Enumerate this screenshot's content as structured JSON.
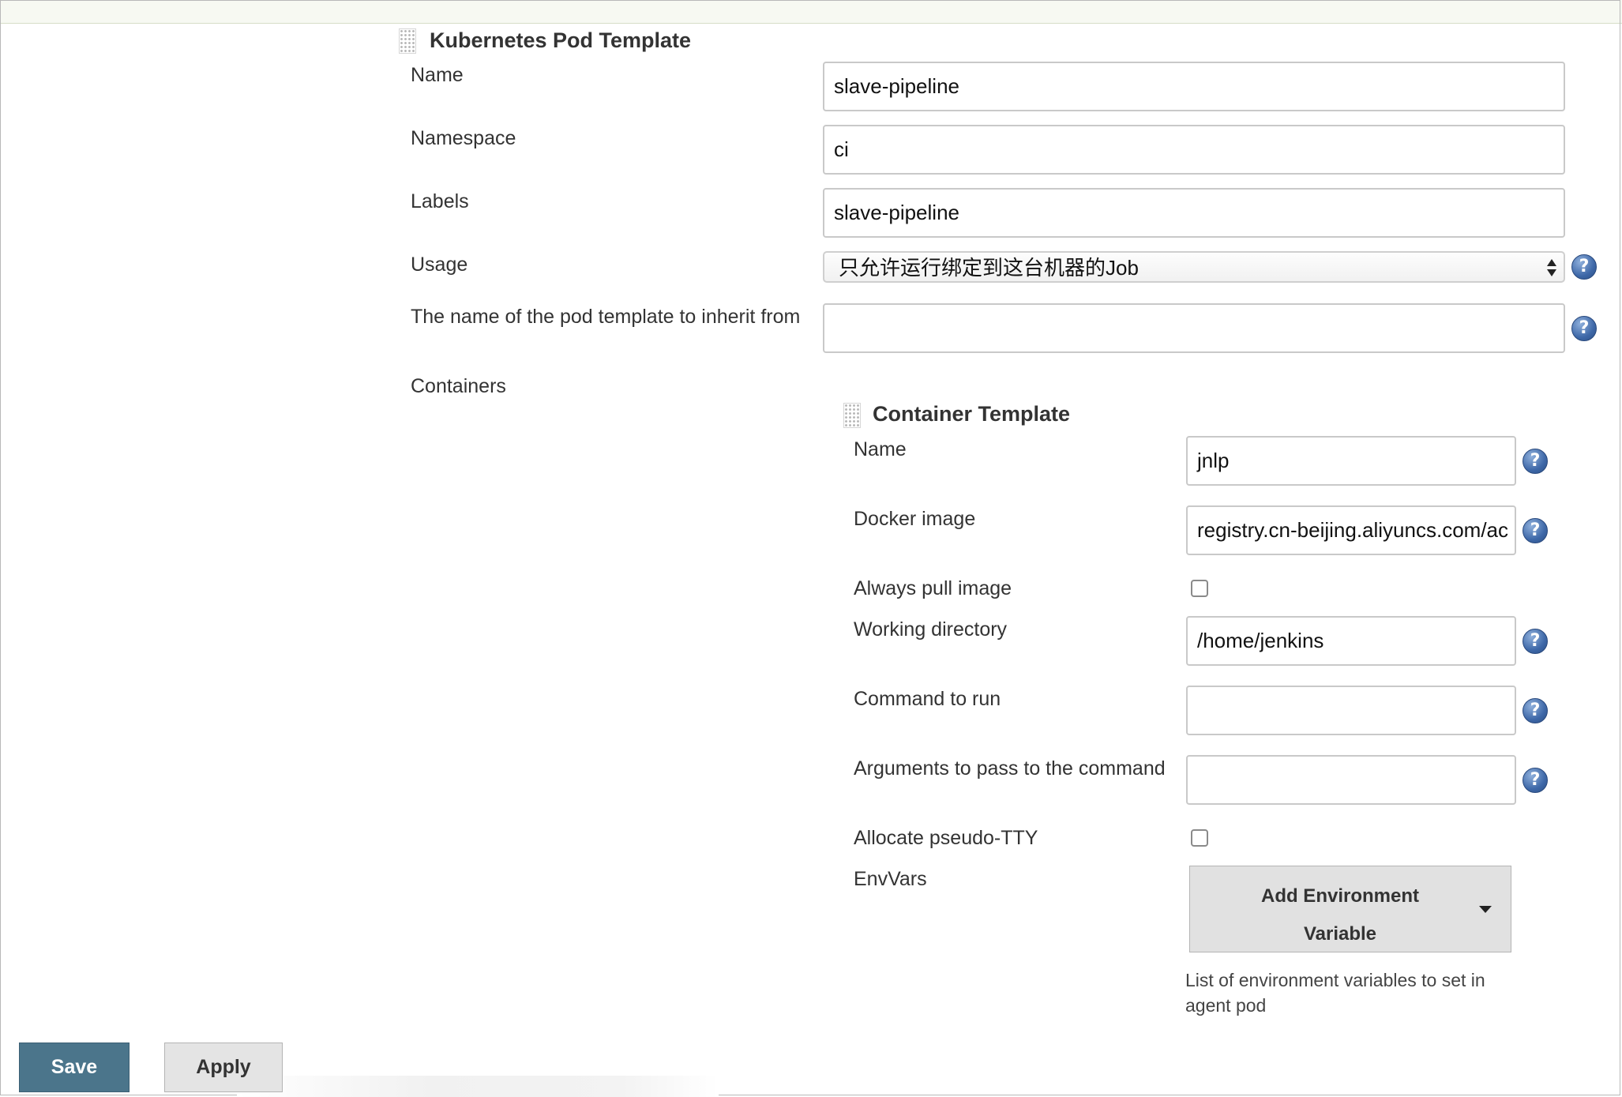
{
  "pod_template": {
    "title": "Kubernetes Pod Template",
    "name": {
      "label": "Name",
      "value": "slave-pipeline"
    },
    "namespace": {
      "label": "Namespace",
      "value": "ci"
    },
    "labels": {
      "label": "Labels",
      "value": "slave-pipeline"
    },
    "usage": {
      "label": "Usage",
      "value": "只允许运行绑定到这台机器的Job"
    },
    "inherit_from": {
      "label": "The name of the pod template to inherit from",
      "value": ""
    },
    "containers_label": "Containers"
  },
  "container_template": {
    "title": "Container Template",
    "name": {
      "label": "Name",
      "value": "jnlp"
    },
    "docker_image": {
      "label": "Docker image",
      "value": "registry.cn-beijing.aliyuncs.com/ac"
    },
    "always_pull": {
      "label": "Always pull image",
      "checked": false
    },
    "working_dir": {
      "label": "Working directory",
      "value": "/home/jenkins"
    },
    "command": {
      "label": "Command to run",
      "value": ""
    },
    "args": {
      "label": "Arguments to pass to the command",
      "value": ""
    },
    "tty": {
      "label": "Allocate pseudo-TTY",
      "checked": false
    },
    "envvars": {
      "label": "EnvVars",
      "button_line1": "Add Environment",
      "button_line2": "Variable",
      "description": "List of environment variables to set in agent pod"
    }
  },
  "help_glyph": "?",
  "buttons": {
    "save": "Save",
    "apply": "Apply"
  },
  "colors": {
    "save_button": "#4b758b",
    "help_icon": "#3e68a8",
    "input_border": "#c9c9c9"
  }
}
